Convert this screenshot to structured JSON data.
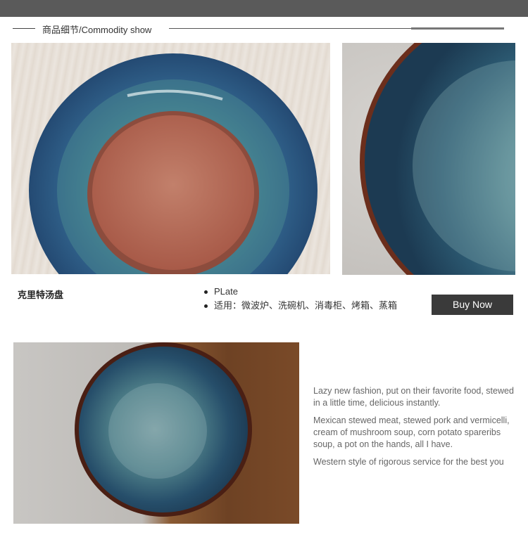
{
  "section": {
    "title": "商品细节/Commodity show"
  },
  "product": {
    "name": "克里特汤盘",
    "features": [
      "PLate",
      "适用：微波炉、洗碗机、消毒柜、烤箱、蒸箱"
    ],
    "buy_label": "Buy Now"
  },
  "description": {
    "paragraphs": [
      "Lazy new fashion, put on their favorite food, stewed in a little time, delicious instantly.",
      "Mexican stewed meat, stewed pork and vermicelli, cream of mushroom soup, corn potato spareribs soup, a pot on the hands, all I have.",
      "Western style of rigorous service for the  best you"
    ]
  },
  "colors": {
    "topbar": "#5a5a5a",
    "button_bg": "#3a3a3a",
    "glaze_blue": "#2f5f86",
    "clay": "#b86a55"
  }
}
